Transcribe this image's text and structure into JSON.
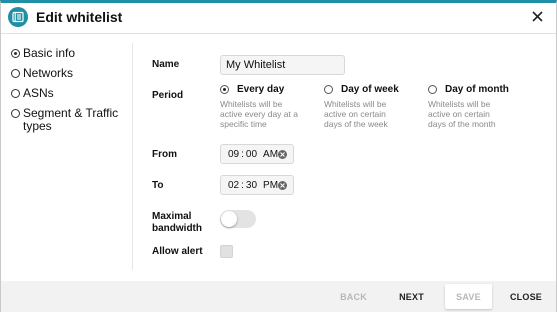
{
  "dialog": {
    "title": "Edit whitelist",
    "icons": {
      "app": "list-icon",
      "close": "close-icon"
    }
  },
  "nav": {
    "items": [
      {
        "label": "Basic info",
        "selected": true
      },
      {
        "label": "Networks",
        "selected": false
      },
      {
        "label": "ASNs",
        "selected": false
      },
      {
        "label": "Segment & Traffic types",
        "selected": false
      }
    ]
  },
  "form": {
    "name_label": "Name",
    "name_value": "My Whitelist",
    "period_label": "Period",
    "period_options": [
      {
        "label": "Every day",
        "description": "Whitelists will be active every day at a specific time",
        "selected": true
      },
      {
        "label": "Day of week",
        "description": "Whitelists will be active on certain days of the week",
        "selected": false
      },
      {
        "label": "Day of month",
        "description": "Whitelists will be active on certain days of the month",
        "selected": false
      }
    ],
    "from_label": "From",
    "from_time": {
      "hour": "09",
      "minute": "00",
      "ampm": "AM"
    },
    "to_label": "To",
    "to_time": {
      "hour": "02",
      "minute": "30",
      "ampm": "PM"
    },
    "bandwidth_label": "Maximal bandwidth",
    "bandwidth_enabled": false,
    "alert_label": "Allow alert",
    "alert_checked": false
  },
  "footer": {
    "back": "BACK",
    "next": "NEXT",
    "save": "SAVE",
    "close": "CLOSE"
  },
  "colors": {
    "accent": "#1f8fa6",
    "disabled_text": "#b7b7b7",
    "footer_bg": "#f2f2f2"
  }
}
